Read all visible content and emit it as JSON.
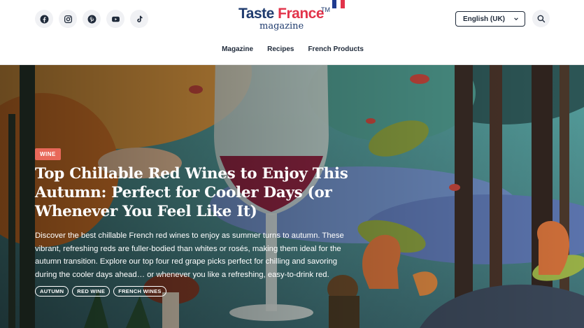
{
  "header": {
    "social": [
      {
        "name": "facebook-icon"
      },
      {
        "name": "instagram-icon"
      },
      {
        "name": "pinterest-icon"
      },
      {
        "name": "youtube-icon"
      },
      {
        "name": "tiktok-icon"
      }
    ],
    "logo": {
      "taste": "Taste",
      "france": "France",
      "tm": "TM",
      "sub": "magazine"
    },
    "flag_colors": [
      "#1f3b8f",
      "#ffffff",
      "#e2334a"
    ],
    "language": "English (UK)",
    "search_icon": "search-icon"
  },
  "nav": {
    "items": [
      "Magazine",
      "Recipes",
      "French Products"
    ]
  },
  "article": {
    "category": "WINE",
    "title": "Top Chillable Red Wines to Enjoy This Autumn: Perfect for Cooler Days (or Whenever You Feel Like It)",
    "excerpt": "Discover the best chillable French red wines to enjoy as summer turns to autumn. These vibrant, refreshing reds are fuller-bodied than whites or rosés, making them ideal for the autumn transition. Explore our top four red grape picks perfect for chilling and savoring during the cooler days ahead… or whenever you like a refreshing, easy-to-drink red.",
    "tags": [
      "AUTUMN",
      "RED WINE",
      "FRENCH WINES"
    ]
  },
  "colors": {
    "accent": "#e8685a",
    "brand_navy": "#1f3b6e",
    "brand_red": "#e2334a"
  }
}
